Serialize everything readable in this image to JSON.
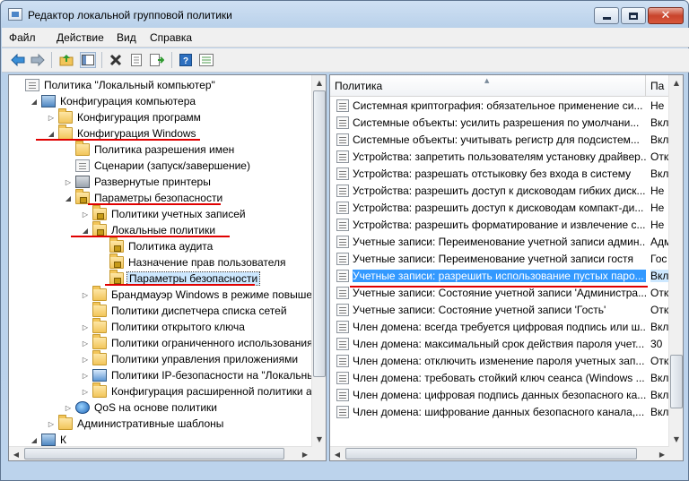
{
  "window": {
    "title": "Редактор локальной групповой политики",
    "close_glyph": "✕"
  },
  "menu": [
    "Файл",
    "Действие",
    "Вид",
    "Справка"
  ],
  "toolbar_icons": [
    "back-arrow-icon",
    "forward-arrow-icon",
    "up-folder-icon",
    "show-tree-icon",
    "delete-icon",
    "properties-icon",
    "export-list-icon",
    "help-icon",
    "filter-icon"
  ],
  "tree": [
    {
      "label": "Политика \"Локальный компьютер\"",
      "icon": "policy",
      "toggle": ""
    },
    {
      "label": "Конфигурация компьютера",
      "icon": "computer",
      "toggle": "◢"
    },
    {
      "label": "Конфигурация программ",
      "icon": "folder",
      "toggle": "▷"
    },
    {
      "label": "Конфигурация Windows",
      "icon": "folder",
      "toggle": "◢"
    },
    {
      "label": "Политика разрешения имен",
      "icon": "folder",
      "toggle": ""
    },
    {
      "label": "Сценарии (запуск/завершение)",
      "icon": "policy",
      "toggle": ""
    },
    {
      "label": "Развернутые принтеры",
      "icon": "printer",
      "toggle": "▷"
    },
    {
      "label": "Параметры безопасности",
      "icon": "folder-lock",
      "toggle": "◢"
    },
    {
      "label": "Политики учетных записей",
      "icon": "folder-lock",
      "toggle": "▷"
    },
    {
      "label": "Локальные политики",
      "icon": "folder-lock",
      "toggle": "◢"
    },
    {
      "label": "Политика аудита",
      "icon": "folder-lock",
      "toggle": ""
    },
    {
      "label": "Назначение прав пользователя",
      "icon": "folder-lock",
      "toggle": ""
    },
    {
      "label": "Параметры безопасности",
      "icon": "folder-lock",
      "toggle": ""
    },
    {
      "label": "Брандмауэр Windows в режиме повышенн",
      "icon": "folder",
      "toggle": "▷"
    },
    {
      "label": "Политики диспетчера списка сетей",
      "icon": "folder",
      "toggle": ""
    },
    {
      "label": "Политики открытого ключа",
      "icon": "folder",
      "toggle": "▷"
    },
    {
      "label": "Политики ограниченного использования п",
      "icon": "folder",
      "toggle": "▷"
    },
    {
      "label": "Политики управления приложениями",
      "icon": "folder",
      "toggle": "▷"
    },
    {
      "label": "Политики IP-безопасности на \"Локальный",
      "icon": "ipsec",
      "toggle": "▷"
    },
    {
      "label": "Конфигурация расширенной политики ауд",
      "icon": "folder",
      "toggle": "▷"
    },
    {
      "label": "QoS на основе политики",
      "icon": "qos",
      "toggle": "▷"
    },
    {
      "label": "Административные шаблоны",
      "icon": "folder",
      "toggle": "▷"
    },
    {
      "label": "К",
      "icon": "computer",
      "toggle": "◢"
    }
  ],
  "list": {
    "columns": {
      "policy": "Политика",
      "param": "Па"
    },
    "rows": [
      {
        "name": "Системная криптография: обязательное применение си...",
        "value": "Не"
      },
      {
        "name": "Системные объекты: усилить разрешения по умолчани...",
        "value": "Вкл"
      },
      {
        "name": "Системные объекты: учитывать регистр для подсистем...",
        "value": "Вкл"
      },
      {
        "name": "Устройства: запретить пользователям установку драйвер...",
        "value": "Отк"
      },
      {
        "name": "Устройства: разрешать отстыковку без входа в систему",
        "value": "Вкл"
      },
      {
        "name": "Устройства: разрешить доступ к дисководам гибких диск...",
        "value": "Не"
      },
      {
        "name": "Устройства: разрешить доступ к дисководам компакт-ди...",
        "value": "Не"
      },
      {
        "name": "Устройства: разрешить форматирование и извлечение с...",
        "value": "Не"
      },
      {
        "name": "Учетные записи: Переименование учетной записи админ...",
        "value": "Адм"
      },
      {
        "name": "Учетные записи: Переименование учетной записи гостя",
        "value": "Гос"
      },
      {
        "name": "Учетные записи: разрешить использование пустых паро...",
        "value": "Вкл"
      },
      {
        "name": "Учетные записи: Состояние учетной записи 'Администра...",
        "value": "Отк"
      },
      {
        "name": "Учетные записи: Состояние учетной записи 'Гость'",
        "value": "Отк"
      },
      {
        "name": "Член домена: всегда требуется цифровая подпись или ш...",
        "value": "Вкл"
      },
      {
        "name": "Член домена: максимальный срок действия пароля учет...",
        "value": "30"
      },
      {
        "name": "Член домена: отключить изменение пароля учетных зап...",
        "value": "Отк"
      },
      {
        "name": "Член домена: требовать стойкий ключ сеанса (Windows ...",
        "value": "Вкл"
      },
      {
        "name": "Член домена: цифровая подпись данных безопасного ка...",
        "value": "Вкл"
      },
      {
        "name": "Член домена: шифрование данных безопасного канала,...",
        "value": "Вкл"
      }
    ]
  },
  "colors": {
    "selection": "#3399ff",
    "annotation": "#e00000"
  }
}
